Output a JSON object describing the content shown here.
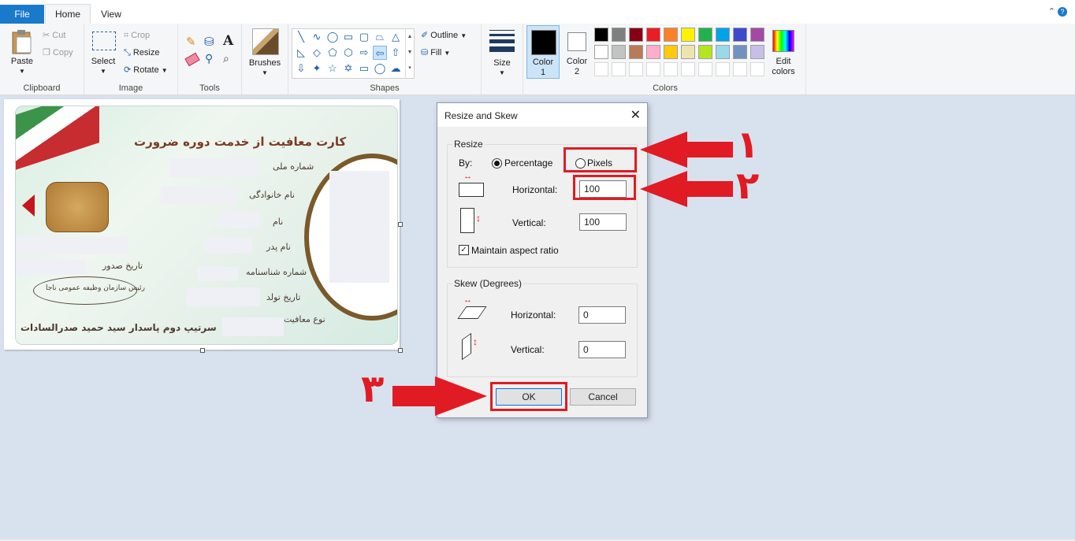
{
  "tabs": {
    "file": "File",
    "home": "Home",
    "view": "View"
  },
  "ribbon": {
    "clipboard": {
      "label": "Clipboard",
      "paste": "Paste",
      "cut": "Cut",
      "copy": "Copy"
    },
    "image": {
      "label": "Image",
      "select": "Select",
      "crop": "Crop",
      "resize": "Resize",
      "rotate": "Rotate"
    },
    "tools": {
      "label": "Tools"
    },
    "brushes": {
      "label": "Brushes"
    },
    "shapes": {
      "label": "Shapes",
      "outline": "Outline",
      "fill": "Fill"
    },
    "size": {
      "label": "Size"
    },
    "color1": {
      "line1": "Color",
      "line2": "1",
      "value": "#000000"
    },
    "color2": {
      "line1": "Color",
      "line2": "2",
      "value": "#ffffff"
    },
    "colors": {
      "label": "Colors",
      "row1": [
        "#000000",
        "#7f7f7f",
        "#880015",
        "#ed1c24",
        "#ff7f27",
        "#fff200",
        "#22b14c",
        "#00a2e8",
        "#3f48cc",
        "#a349a4"
      ],
      "row2": [
        "#ffffff",
        "#c3c3c3",
        "#b97a57",
        "#ffaec9",
        "#ffc90e",
        "#efe4b0",
        "#b5e61d",
        "#99d9ea",
        "#7092be",
        "#c8bfe7"
      ]
    },
    "edit_colors": {
      "line1": "Edit",
      "line2": "colors"
    }
  },
  "card": {
    "header": "کارت معافیت از خدمت دوره ضرورت",
    "fields": [
      "شماره ملی",
      "نام خانوادگی",
      "نام",
      "نام پدر",
      "شماره شناسنامه",
      "تاریخ تولد",
      "نوع معافیت",
      "تاریخ صدور"
    ],
    "seal": "رئیس سازمان وظیفه عمومی ناجا",
    "signature": "سرتیپ دوم پاسدار سید حمید صدرالسادات"
  },
  "dialog": {
    "title": "Resize and Skew",
    "resize_legend": "Resize",
    "by": "By:",
    "percentage": "Percentage",
    "pixels": "Pixels",
    "horizontal_label": "Horizontal:",
    "vertical_label": "Vertical:",
    "resize_h": "100",
    "resize_v": "100",
    "maintain": "Maintain aspect ratio",
    "skew_legend": "Skew (Degrees)",
    "skew_h": "0",
    "skew_v": "0",
    "ok": "OK",
    "cancel": "Cancel"
  },
  "annotations": {
    "n1": "۱",
    "n2": "۲",
    "n3": "۳",
    "color": "#e01b24"
  }
}
